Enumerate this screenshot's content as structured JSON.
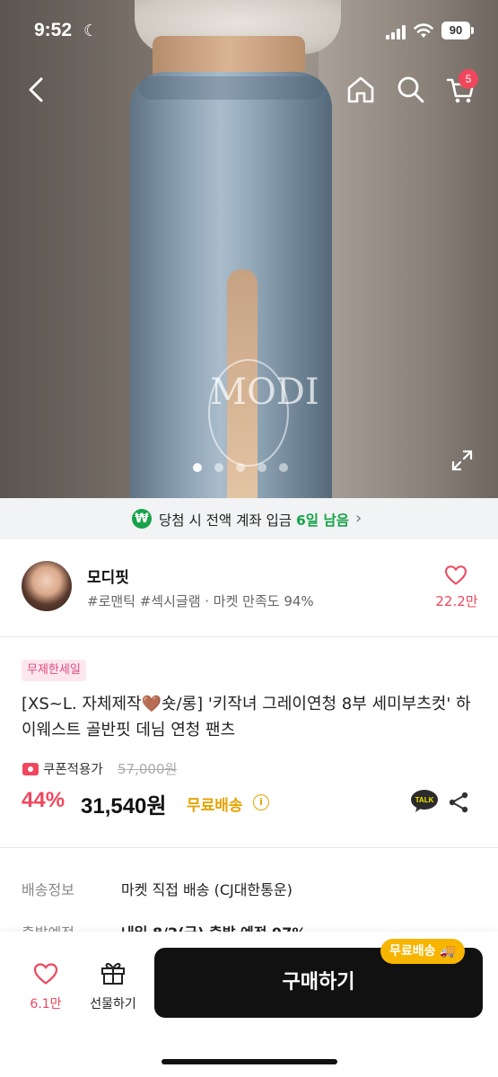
{
  "status_bar": {
    "time": "9:52",
    "battery": "90"
  },
  "header": {
    "cart_count": "5",
    "icons": [
      "back-icon",
      "home-icon",
      "search-icon",
      "cart-icon"
    ]
  },
  "hero": {
    "watermark": "MODI",
    "image_count": 5,
    "current_image": 1
  },
  "banner": {
    "text_prefix": "당첨 시 전액 계좌 입금",
    "days_left": "6일 남음"
  },
  "seller": {
    "name": "모디핏",
    "tags": "#로맨틱 #섹시글램 · 마켓 만족도 94%",
    "likes": "22.2만"
  },
  "product": {
    "sale_badge": "무제한세일",
    "title": "[XS~L. 자체제작🤎숏/롱] '키작녀 그레이연청 8부 세미부츠컷' 하이웨스트 골반핏 데님 연청 팬츠",
    "coupon_label": "쿠폰적용가",
    "original_price": "57,000원",
    "discount": "44%",
    "price": "31,540원",
    "free_shipping": "무료배송",
    "info_symbol": "i",
    "talk_label": "TALK"
  },
  "delivery": {
    "label": "배송정보",
    "value": "마켓 직접 배송 (CJ대한통운)",
    "label2": "출발예정",
    "value2": "내일 8/2(금) 출발 예정 97%"
  },
  "bottom_bar": {
    "wish_count": "6.1만",
    "gift_label": "선물하기",
    "buy_label": "구매하기",
    "free_tag": "무료배송 🚚"
  },
  "colors": {
    "accent_pink": "#f0475c",
    "free_ship_yellow": "#e5a400",
    "banner_green": "#16a34a",
    "buy_button": "#111111"
  }
}
